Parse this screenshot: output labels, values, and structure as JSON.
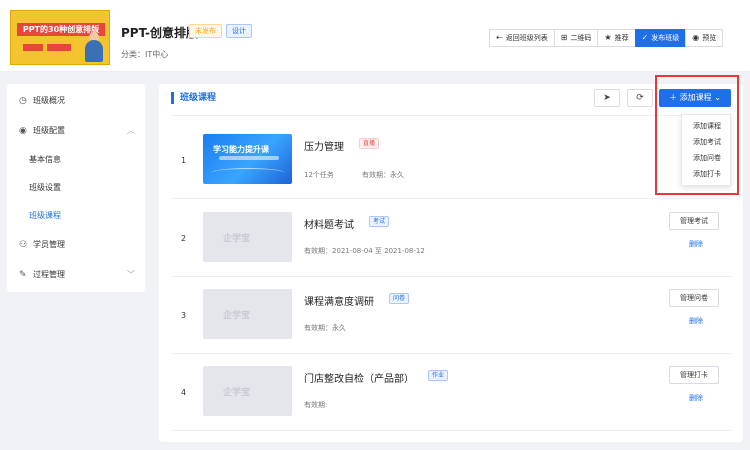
{
  "header": {
    "course_title": "PPT-创意排版",
    "thumbnail_text": "PPT的30种创意排版",
    "status_badge": "未发布",
    "type_badge": "设计",
    "category_label": "分类：",
    "category_value": "IT中心",
    "actions": [
      {
        "icon": "return-icon",
        "glyph": "⇠",
        "label": "返回班级列表"
      },
      {
        "icon": "qrcode-icon",
        "glyph": "⊞",
        "label": "二维码"
      },
      {
        "icon": "star-icon",
        "glyph": "★",
        "label": "推荐"
      },
      {
        "icon": "check-icon",
        "glyph": "✓",
        "label": "发布班级"
      },
      {
        "icon": "eye-icon",
        "glyph": "◉",
        "label": "预览"
      }
    ]
  },
  "sidebar": {
    "items": [
      {
        "icon": "overview-icon",
        "glyph": "◷",
        "label": "班级概况"
      },
      {
        "icon": "settings-icon",
        "glyph": "◉",
        "label": "班级配置",
        "chevron": "︿"
      },
      {
        "label": "基本信息"
      },
      {
        "label": "班级设置"
      },
      {
        "label": "班级课程",
        "active": true
      },
      {
        "icon": "user-icon",
        "glyph": "⚇",
        "label": "学员管理"
      },
      {
        "icon": "edit-icon",
        "glyph": "✎",
        "label": "过程管理",
        "chevron": "﹀"
      }
    ]
  },
  "main": {
    "title": "班级课程",
    "send_icon": "send-icon",
    "refresh_icon": "refresh-icon",
    "add_button": "添加课程",
    "dropdown": [
      "添加课程",
      "添加考试",
      "添加问卷",
      "添加打卡"
    ],
    "rows": [
      {
        "index": "1",
        "name": "压力管理",
        "tag": "直播",
        "cover_title": "学习能力提升课",
        "meta1": "12个任务",
        "meta2": "有效期：永久",
        "manage": "",
        "delete": ""
      },
      {
        "index": "2",
        "name": "材料题考试",
        "tag": "考试",
        "cover_logo": "企学宝",
        "meta1": "有效期：2021-08-04 至 2021-08-12",
        "manage": "管理考试",
        "delete": "删除"
      },
      {
        "index": "3",
        "name": "课程满意度调研",
        "tag": "问卷",
        "cover_logo": "企学宝",
        "meta1": "有效期：永久",
        "manage": "管理问卷",
        "delete": "删除"
      },
      {
        "index": "4",
        "name": "门店整改自检（产品部）",
        "tag": "作业",
        "cover_logo": "企学宝",
        "meta1": "有效期:",
        "manage": "管理打卡",
        "delete": "删除"
      }
    ]
  },
  "colors": {
    "accent": "#1e6fe8",
    "highlight": "#e53935",
    "live": "#e5484d",
    "warning": "#f5a623"
  }
}
